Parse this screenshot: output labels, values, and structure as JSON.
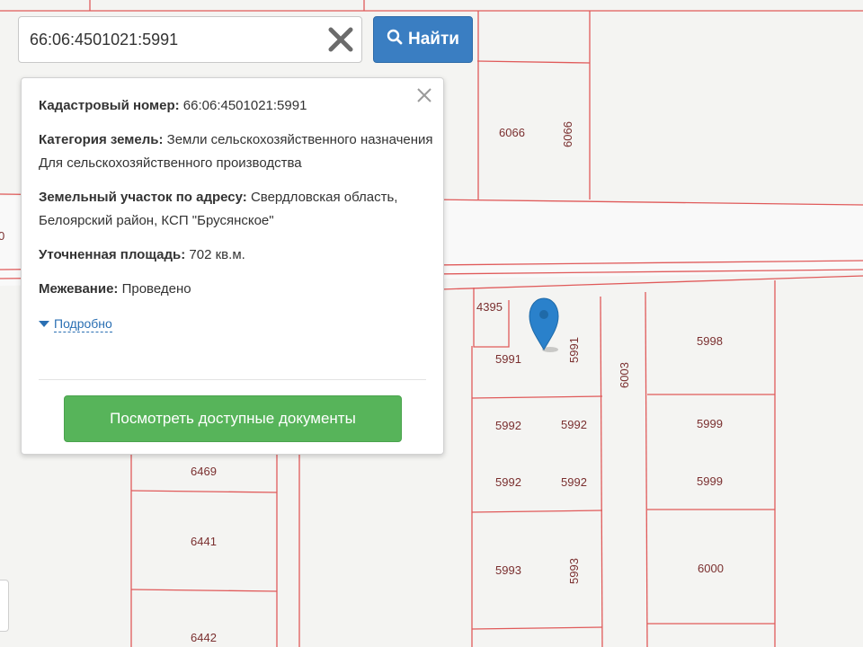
{
  "search": {
    "value": "66:06:4501021:5991",
    "button_label": "Найти"
  },
  "popup": {
    "cadastral_label": "Кадастровый номер:",
    "cadastral_value": "66:06:4501021:5991",
    "category_label": "Категория земель:",
    "category_value": "Земли сельскохозяйственного назначения",
    "category_use": "Для сельскохозяйственного производства",
    "address_label": "Земельный участок по адресу:",
    "address_value": "Свердловская область, Белоярский район, КСП \"Брусянское\"",
    "area_label": "Уточненная площадь:",
    "area_value": "702 кв.м.",
    "survey_label": "Межевание:",
    "survey_value": "Проведено",
    "more_label": "Подробно",
    "docs_button": "Посмотреть доступные документы"
  },
  "map": {
    "parcel_labels": {
      "p6066a": "6066",
      "p6066b": "6066",
      "p4395": "4395",
      "p5991a": "5991",
      "p5991b": "5991",
      "p6003": "6003",
      "p5998": "5998",
      "p5992a": "5992",
      "p5992b": "5992",
      "p5992c": "5992",
      "p5992d": "5992",
      "p5999a": "5999",
      "p5999b": "5999",
      "p6469": "6469",
      "p6441": "6441",
      "p5993a": "5993",
      "p5993b": "5993",
      "p6000": "6000",
      "p6442": "6442",
      "edge0": "0"
    },
    "colors": {
      "parcel_line": "#e05a5a",
      "label": "#7a2f2f",
      "marker": "#2a81cb"
    }
  }
}
